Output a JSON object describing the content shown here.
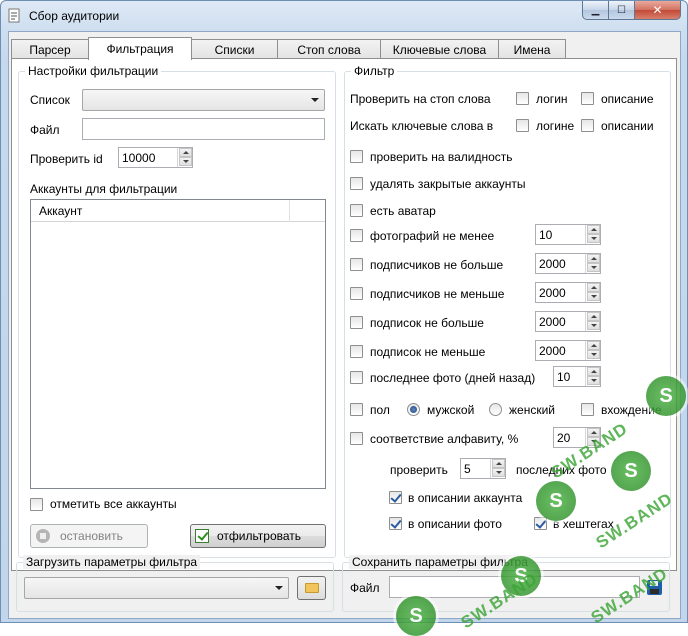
{
  "window": {
    "title": "Сбор аудитории",
    "close_glyph": "✕",
    "min_glyph": "▁",
    "max_glyph": "☐"
  },
  "tabs": [
    {
      "label": "Парсер"
    },
    {
      "label": "Фильтрация"
    },
    {
      "label": "Списки"
    },
    {
      "label": "Стоп слова"
    },
    {
      "label": "Ключевые слова"
    },
    {
      "label": "Имена"
    }
  ],
  "settings": {
    "group_title": "Настройки фильтрации",
    "list_label": "Список",
    "list_value": "",
    "file_label": "Файл",
    "file_value": "",
    "check_id_label": "Проверить id",
    "check_id_value": "10000",
    "accounts_title": "Аккаунты для фильтрации",
    "accounts_column": "Аккаунт",
    "select_all_label": "отметить все аккаунты",
    "stop_button": "остановить",
    "filter_button": "отфильтровать"
  },
  "filter": {
    "group_title": "Фильтр",
    "stopword_label": "Проверить на стоп слова",
    "stopword_login": "логин",
    "stopword_desc": "описание",
    "keyword_label": "Искать ключевые слова в",
    "keyword_login": "логине",
    "keyword_desc": "описании",
    "validity": "проверить на валидность",
    "remove_closed": "удалять закрытые аккаунты",
    "has_avatar": "есть аватар",
    "photos_min": "фотографий не менее",
    "photos_min_val": "10",
    "subs_max": "подписчиков не больше",
    "subs_max_val": "2000",
    "subs_min": "подписчиков не меньше",
    "subs_min_val": "2000",
    "follow_max": "подписок не больше",
    "follow_max_val": "2000",
    "follow_min": "подписок не меньше",
    "follow_min_val": "2000",
    "last_photo": "последнее фото (дней назад)",
    "last_photo_val": "10",
    "gender": "пол",
    "male": "мужской",
    "female": "женский",
    "entry": "вхождение",
    "alphabet": "соответствие алфавиту, %",
    "alphabet_val": "20",
    "check_prefix": "проверить",
    "check_count": "5",
    "check_suffix": "последних фото",
    "in_account_desc": "в описании аккаунта",
    "in_photo_desc": "в описании фото",
    "in_hashtags": "в хештегах"
  },
  "load": {
    "group_title": "Загрузить параметры фильтра",
    "value": ""
  },
  "save": {
    "group_title": "Сохранить параметры фильтра",
    "file_label": "Файл",
    "value": ""
  },
  "watermark": {
    "text": "SW.BAND",
    "glyph": "S"
  }
}
